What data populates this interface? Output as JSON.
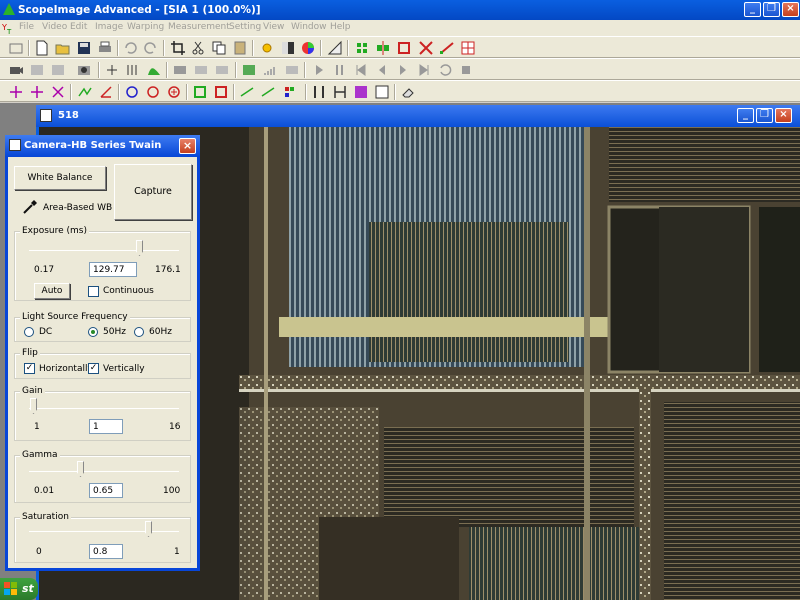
{
  "app": {
    "title": "ScopeImage Advanced - [SIA 1 (100.0%)]"
  },
  "menu": [
    "File",
    "Video",
    "Edit",
    "Image",
    "Warping",
    "Measurement",
    "Setting",
    "View",
    "Window",
    "Help"
  ],
  "image_window": {
    "title": "518"
  },
  "dialog": {
    "title": "Camera-HB Series Twain",
    "white_balance_label": "White Balance",
    "capture_label": "Capture",
    "area_wb_label": "Area-Based WB",
    "exposure": {
      "label": "Exposure (ms)",
      "min": "0.17",
      "value": "129.77",
      "max": "176.1",
      "auto_label": "Auto",
      "continuous_label": "Continuous",
      "continuous_checked": false
    },
    "light_source": {
      "label": "Light Source Frequency",
      "options": [
        "DC",
        "50Hz",
        "60Hz"
      ],
      "selected": "50Hz"
    },
    "flip": {
      "label": "Flip",
      "horizontal_label": "Horizontally",
      "vertical_label": "Vertically",
      "horizontal": true,
      "vertical": true
    },
    "gain": {
      "label": "Gain",
      "min": "1",
      "value": "1",
      "max": "16"
    },
    "gamma": {
      "label": "Gamma",
      "min": "0.01",
      "value": "0.65",
      "max": "100"
    },
    "saturation": {
      "label": "Saturation",
      "min": "0",
      "value": "0.8",
      "max": "1"
    }
  },
  "taskbar": {
    "start_label": "st"
  }
}
